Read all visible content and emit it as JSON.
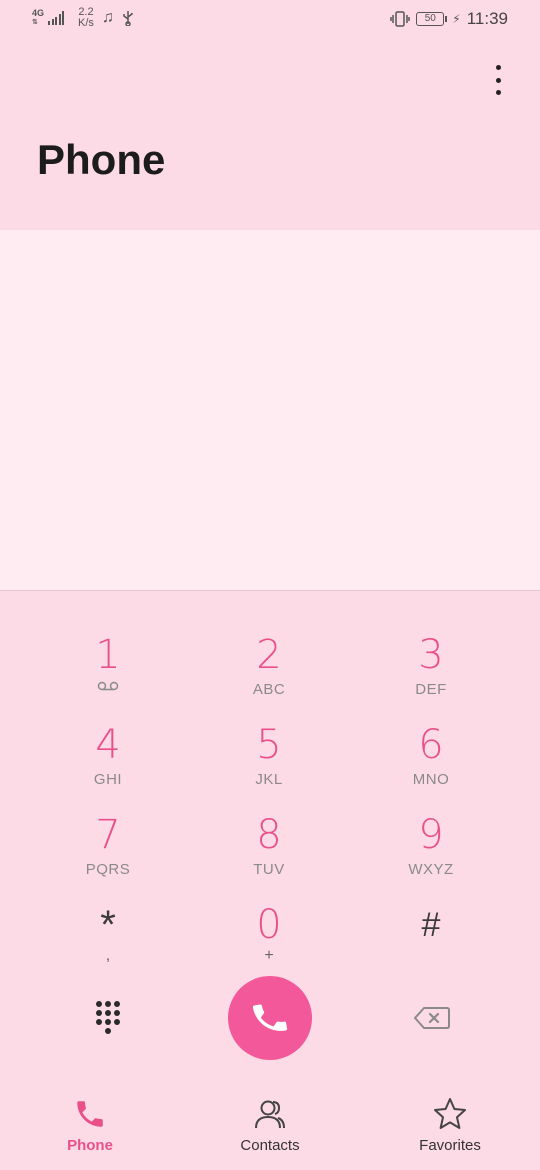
{
  "status_bar": {
    "network": "4G",
    "speed_value": "2.2",
    "speed_unit": "K/s",
    "battery": "50",
    "time": "11:39",
    "icons": [
      "signal-icon",
      "music-note-icon",
      "usb-icon",
      "vibrate-icon",
      "battery-icon",
      "charging-icon"
    ]
  },
  "header": {
    "title": "Phone",
    "menu_icon": "more-vertical-icon"
  },
  "dialpad": {
    "keys": [
      {
        "digit": "1",
        "sub": ""
      },
      {
        "digit": "2",
        "sub": "ABC"
      },
      {
        "digit": "3",
        "sub": "DEF"
      },
      {
        "digit": "4",
        "sub": "GHI"
      },
      {
        "digit": "5",
        "sub": "JKL"
      },
      {
        "digit": "6",
        "sub": "MNO"
      },
      {
        "digit": "7",
        "sub": "PQRS"
      },
      {
        "digit": "8",
        "sub": "TUV"
      },
      {
        "digit": "9",
        "sub": "WXYZ"
      },
      {
        "digit": "*",
        "sub": ","
      },
      {
        "digit": "0",
        "sub": "+"
      },
      {
        "digit": "#",
        "sub": ""
      }
    ],
    "voicemail_icon": "voicemail-icon",
    "accent_color": "#e9508a",
    "call_button_color": "#f3589a"
  },
  "bottom_nav": {
    "items": [
      {
        "label": "Phone",
        "icon": "phone-icon",
        "active": true
      },
      {
        "label": "Contacts",
        "icon": "contacts-icon",
        "active": false
      },
      {
        "label": "Favorites",
        "icon": "star-icon",
        "active": false
      }
    ]
  },
  "colors": {
    "background": "#fddbe6",
    "number_area": "#ffecf2",
    "active_nav": "#e9508a"
  }
}
